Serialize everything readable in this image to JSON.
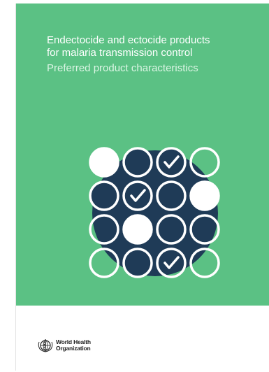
{
  "cover": {
    "title_line1": "Endectocide and ectocide products",
    "title_line2": "for malaria transmission control",
    "subtitle": "Preferred product characteristics",
    "colors": {
      "background": "#5bc184",
      "navy": "#1f3b57",
      "white": "#ffffff"
    }
  },
  "graphic": {
    "rows": [
      [
        "filled-white",
        "navy",
        "check-navy",
        "outline"
      ],
      [
        "navy",
        "check-green",
        "outline",
        "filled-white"
      ],
      [
        "outline",
        "filled-white",
        "outline",
        "outline"
      ],
      [
        "outline",
        "navy",
        "check-outline",
        "outline"
      ]
    ]
  },
  "footer": {
    "org_line1": "World Health",
    "org_line2": "Organization",
    "logo_icon": "who-emblem-icon"
  }
}
